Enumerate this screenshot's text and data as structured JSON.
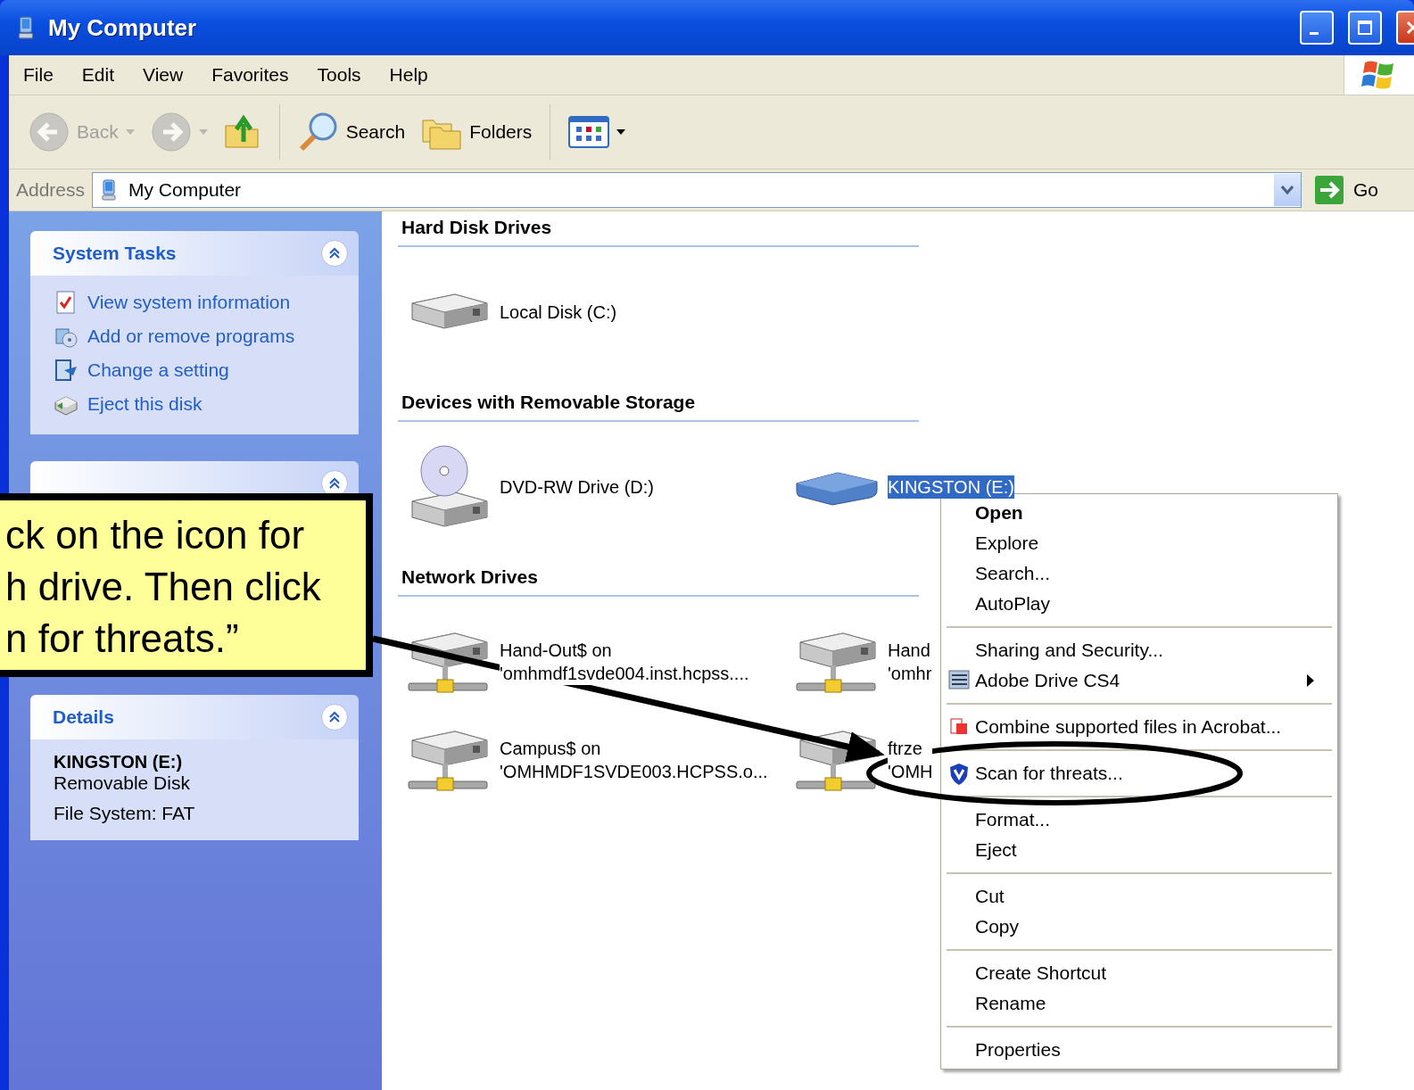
{
  "window": {
    "title": "My Computer"
  },
  "menu_bar": [
    "File",
    "Edit",
    "View",
    "Favorites",
    "Tools",
    "Help"
  ],
  "toolbar": [
    {
      "kind": "back",
      "label": "Back",
      "disabled": true
    },
    {
      "kind": "forward",
      "disabled": true
    },
    {
      "kind": "up",
      "disabled": false
    },
    {
      "kind": "search",
      "label": "Search",
      "disabled": false
    },
    {
      "kind": "folders",
      "label": "Folders",
      "disabled": false
    },
    {
      "kind": "views",
      "disabled": false
    }
  ],
  "address_bar": {
    "label": "Address",
    "value": "My Computer",
    "go": "Go"
  },
  "sidebar": [
    {
      "kind": "tasks",
      "title": "System Tasks",
      "items": [
        {
          "kind": "info",
          "label": "View system information"
        },
        {
          "kind": "programs",
          "label": "Add or remove programs"
        },
        {
          "kind": "setting",
          "label": "Change a setting"
        },
        {
          "kind": "eject",
          "label": "Eject this disk"
        }
      ]
    },
    {
      "kind": "covered"
    },
    {
      "kind": "details",
      "title": "Details",
      "name": "KINGSTON (E:)",
      "type": "Removable Disk",
      "file_system": "File System: FAT"
    }
  ],
  "sections": [
    {
      "title": "Hard Disk Drives",
      "items": [
        {
          "kind": "hdd",
          "lines": [
            "Local Disk (C:)"
          ],
          "selected": false
        }
      ]
    },
    {
      "title": "Devices with Removable Storage",
      "items": [
        {
          "kind": "dvd",
          "lines": [
            "DVD-RW Drive (D:)"
          ],
          "selected": false
        },
        {
          "kind": "usb",
          "lines": [
            "KINGSTON (E:)"
          ],
          "selected": true
        }
      ]
    },
    {
      "title": "Network Drives",
      "items": [
        {
          "kind": "net",
          "lines": [
            "Hand-Out$ on",
            "'omhmdf1svde004.inst.hcpss...."
          ],
          "selected": false
        },
        {
          "kind": "net",
          "lines": [
            "Hand",
            "'omhr"
          ],
          "selected": false
        },
        {
          "kind": "net",
          "lines": [
            "Campus$ on",
            "'OMHMDF1SVDE003.HCPSS.o..."
          ],
          "selected": false
        },
        {
          "kind": "net",
          "lines": [
            "ftrze",
            "'OMH"
          ],
          "selected": false
        }
      ]
    }
  ],
  "context_menu": [
    [
      {
        "kind": "plain",
        "label": "Open",
        "default": true,
        "submenu": false
      },
      {
        "kind": "plain",
        "label": "Explore",
        "default": false,
        "submenu": false
      },
      {
        "kind": "plain",
        "label": "Search...",
        "default": false,
        "submenu": false
      },
      {
        "kind": "plain",
        "label": "AutoPlay",
        "default": false,
        "submenu": false
      }
    ],
    [
      {
        "kind": "plain",
        "label": "Sharing and Security...",
        "default": false,
        "submenu": false
      },
      {
        "kind": "adobe",
        "label": "Adobe Drive CS4",
        "default": false,
        "submenu": true
      }
    ],
    [
      {
        "kind": "acrobat",
        "label": "Combine supported files in Acrobat...",
        "default": false,
        "submenu": false
      }
    ],
    [
      {
        "kind": "shield",
        "label": "Scan for threats...",
        "default": false,
        "submenu": false
      }
    ],
    [
      {
        "kind": "plain",
        "label": "Format...",
        "default": false,
        "submenu": false
      },
      {
        "kind": "plain",
        "label": "Eject",
        "default": false,
        "submenu": false
      }
    ],
    [
      {
        "kind": "plain",
        "label": "Cut",
        "default": false,
        "submenu": false
      },
      {
        "kind": "plain",
        "label": "Copy",
        "default": false,
        "submenu": false
      }
    ],
    [
      {
        "kind": "plain",
        "label": "Create Shortcut",
        "default": false,
        "submenu": false
      },
      {
        "kind": "plain",
        "label": "Rename",
        "default": false,
        "submenu": false
      }
    ],
    [
      {
        "kind": "plain",
        "label": "Properties",
        "default": false,
        "submenu": false
      }
    ]
  ],
  "callout": {
    "lines": [
      "ck on the icon for",
      "h drive. Then click",
      "n for threats.”"
    ]
  }
}
